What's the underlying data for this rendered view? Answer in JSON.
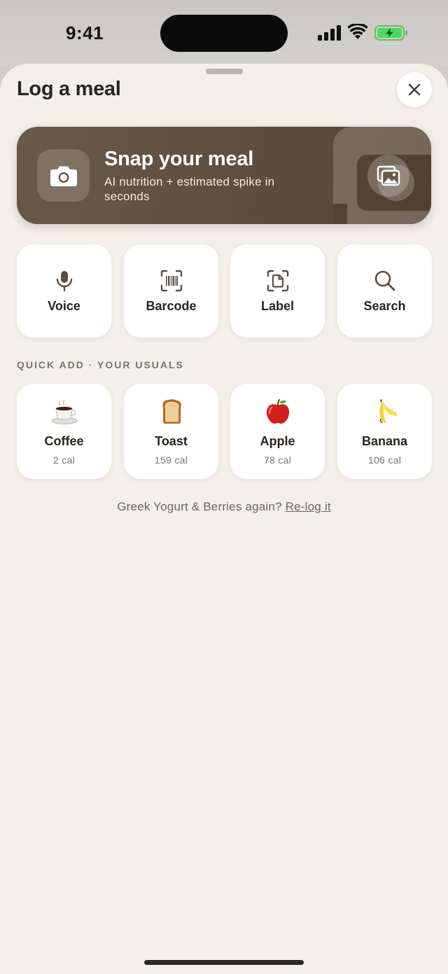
{
  "status_bar": {
    "time": "9:41"
  },
  "sheet": {
    "title": "Log a meal"
  },
  "snap": {
    "title": "Snap your meal",
    "subtitle": "AI nutrition + estimated spike in seconds"
  },
  "actions": [
    {
      "label": "Voice",
      "icon": "microphone-icon"
    },
    {
      "label": "Barcode",
      "icon": "barcode-icon"
    },
    {
      "label": "Label",
      "icon": "label-scan-icon"
    },
    {
      "label": "Search",
      "icon": "search-icon"
    }
  ],
  "quick_add": {
    "heading": "QUICK ADD · YOUR USUALS",
    "items": [
      {
        "name": "Coffee",
        "cal": "2 cal",
        "icon": "coffee-icon"
      },
      {
        "name": "Toast",
        "cal": "159 cal",
        "icon": "toast-icon"
      },
      {
        "name": "Apple",
        "cal": "78 cal",
        "icon": "apple-icon"
      },
      {
        "name": "Banana",
        "cal": "106 cal",
        "icon": "banana-icon"
      }
    ]
  },
  "relog": {
    "prompt": "Greek Yogurt & Berries again?",
    "link": "Re-log it"
  },
  "colors": {
    "sheet_bg": "#f3efe9",
    "snap_card": "#5e4c3d",
    "battery_green": "#4cd964"
  }
}
